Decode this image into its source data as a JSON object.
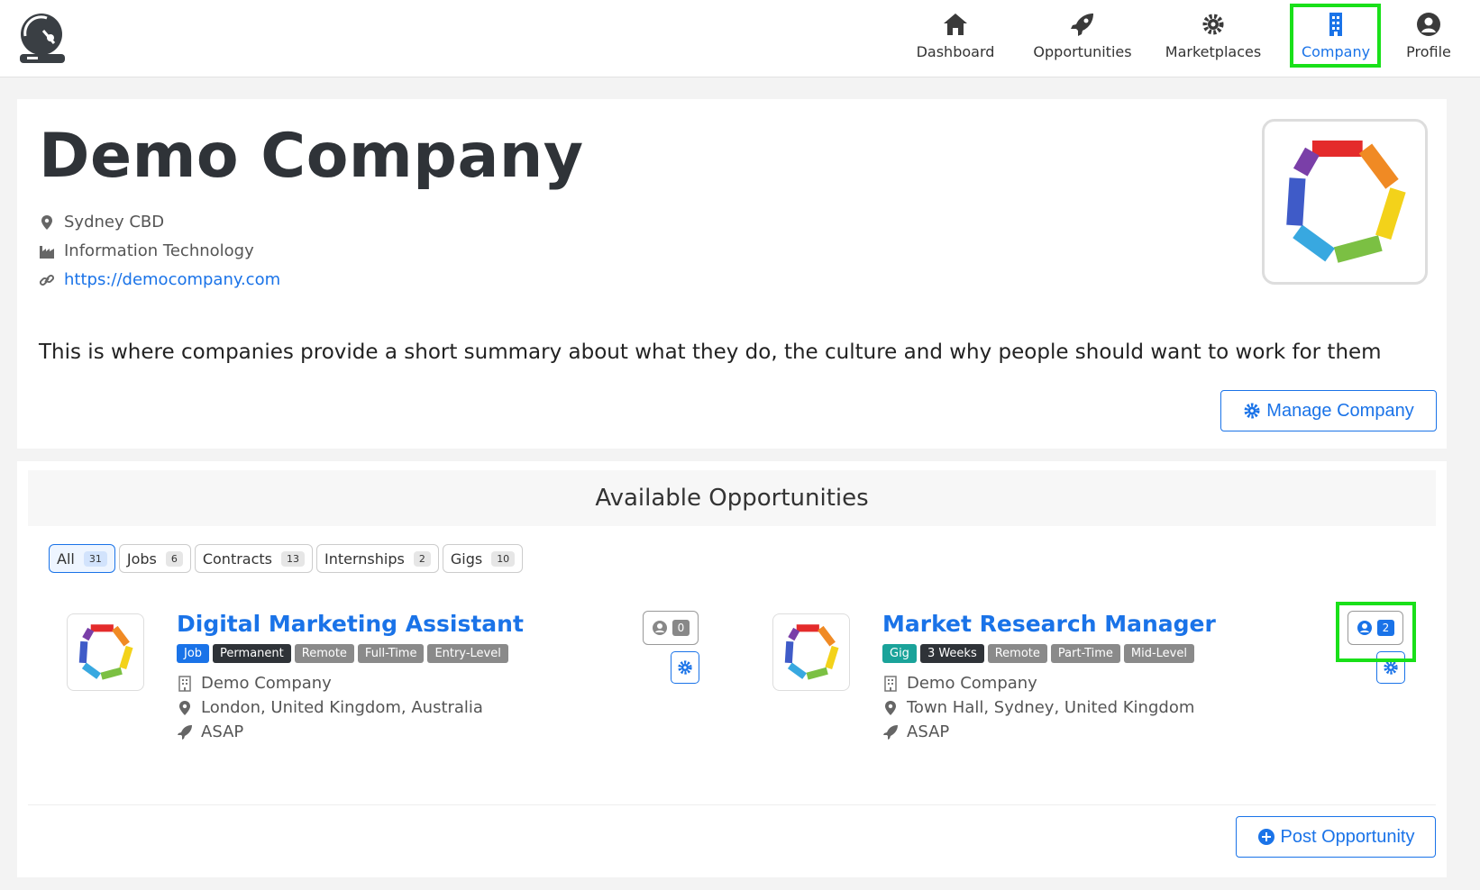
{
  "nav": {
    "items": [
      {
        "label": "Dashboard",
        "icon": "home-icon"
      },
      {
        "label": "Opportunities",
        "icon": "rocket-icon"
      },
      {
        "label": "Marketplaces",
        "icon": "gear-icon"
      },
      {
        "label": "Company",
        "icon": "building-icon",
        "active": true
      },
      {
        "label": "Profile",
        "icon": "user-icon"
      }
    ]
  },
  "company": {
    "name": "Demo Company",
    "location": "Sydney CBD",
    "industry": "Information Technology",
    "website": "https://democompany.com",
    "summary": "This is where companies provide a short summary about what they do, the culture and why people should want to work for them",
    "manage_label": "Manage Company"
  },
  "opportunities": {
    "heading": "Available Opportunities",
    "filters": [
      {
        "label": "All",
        "count": "31"
      },
      {
        "label": "Jobs",
        "count": "6"
      },
      {
        "label": "Contracts",
        "count": "13"
      },
      {
        "label": "Internships",
        "count": "2"
      },
      {
        "label": "Gigs",
        "count": "10"
      }
    ],
    "items": [
      {
        "title": "Digital Marketing Assistant",
        "tags": [
          "Job",
          "Permanent",
          "Remote",
          "Full-Time",
          "Entry-Level"
        ],
        "company": "Demo Company",
        "location": "London, United Kingdom, Australia",
        "start": "ASAP",
        "applicants": "0"
      },
      {
        "title": "Market Research Manager",
        "tags": [
          "Gig",
          "3 Weeks",
          "Remote",
          "Part-Time",
          "Mid-Level"
        ],
        "company": "Demo Company",
        "location": "Town Hall, Sydney, United Kingdom",
        "start": "ASAP",
        "applicants": "2"
      }
    ],
    "post_label": "Post Opportunity"
  },
  "colors": {
    "accent": "#1a73e8",
    "highlight": "#19e019",
    "tag_job": "#1a73e8",
    "tag_gig": "#1aa39a",
    "tag_dark": "#2f3338",
    "tag_gray": "#8a8a8a"
  }
}
